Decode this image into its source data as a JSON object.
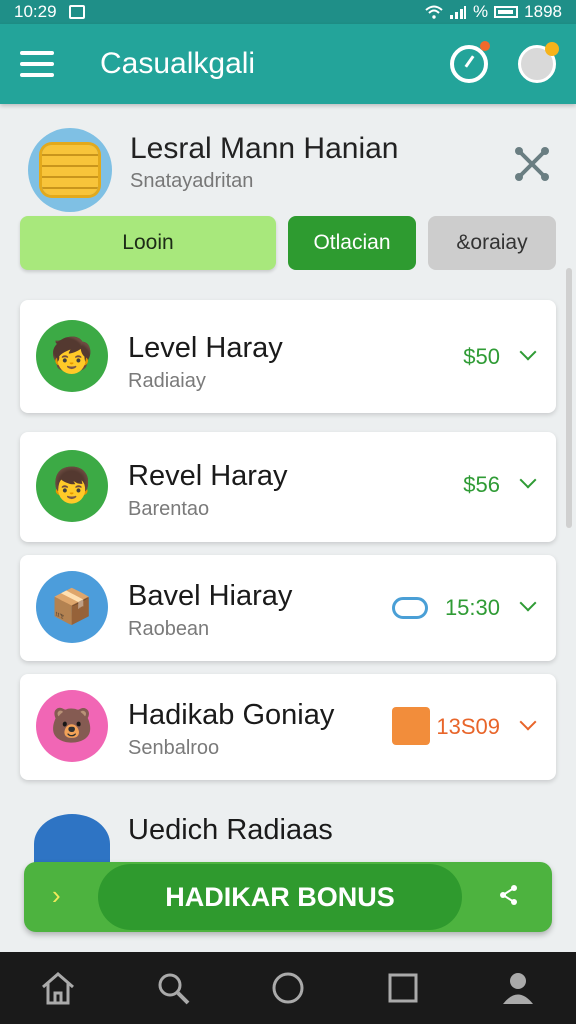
{
  "status": {
    "time": "10:29",
    "right_text": "%",
    "battery_text": "1898"
  },
  "app": {
    "title": "Casualkgali"
  },
  "header": {
    "title": "Lesral Mann Hanian",
    "subtitle": "Snatayadritan",
    "buttons": {
      "login": "Looin",
      "green": "Otlacian",
      "gray": "&oraiay"
    }
  },
  "items": [
    {
      "title": "Level Haray",
      "subtitle": "Radiaiay",
      "value": "$50",
      "icon": "boy-coins-icon"
    },
    {
      "title": "Revel Haray",
      "subtitle": "Barentao",
      "value": "$56",
      "icon": "boy-phone-icon"
    },
    {
      "title": "Bavel Hiaray",
      "subtitle": "Raobean",
      "value": "15:30",
      "icon": "treasure-book-icon",
      "extra_icon": "cloud-icon"
    },
    {
      "title": "Hadikab Goniay",
      "subtitle": "Senbalroo",
      "value": "13S09",
      "icon": "bear-icon",
      "extra_icon": "gift-icon",
      "accent": "#e8652a"
    }
  ],
  "partial_item": {
    "title": "Uedich Radiaas",
    "icon": "chest-icon"
  },
  "bonus": {
    "label": "HADIKAR BONUS",
    "arrow": "›"
  },
  "colors": {
    "appbar": "#23a49a",
    "green": "#2f9b35",
    "bonus": "#4db33f"
  },
  "nav": [
    "home-icon",
    "search-icon",
    "circle-icon",
    "square-icon",
    "profile-icon"
  ]
}
